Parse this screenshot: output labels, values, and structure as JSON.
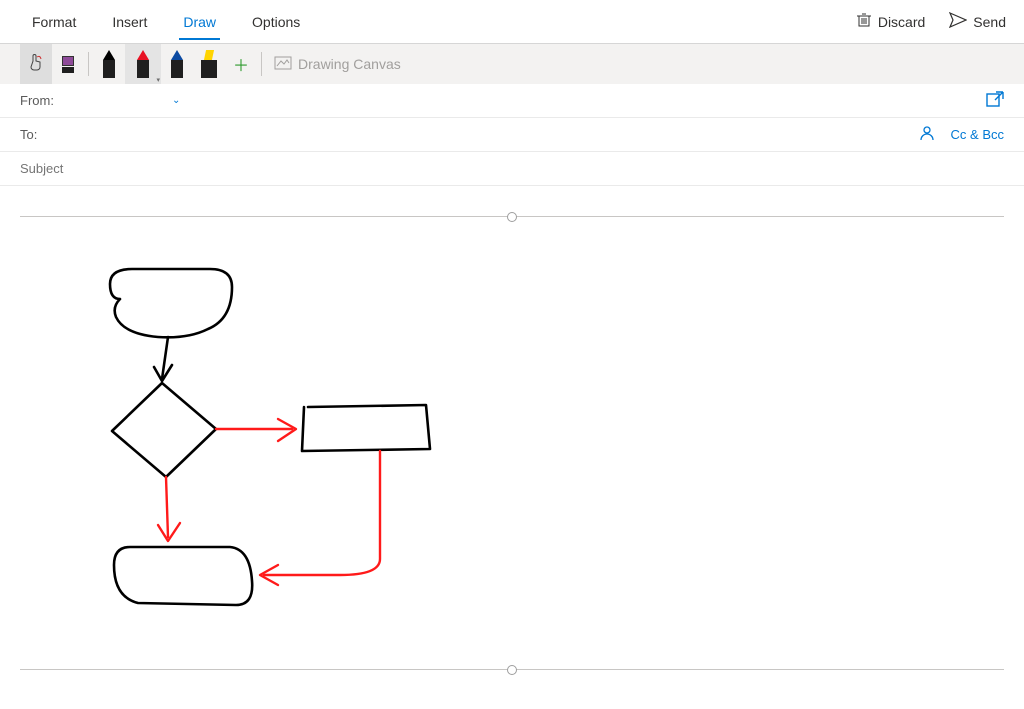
{
  "ribbon": {
    "tabs": {
      "format": "Format",
      "insert": "Insert",
      "draw": "Draw",
      "options": "Options"
    },
    "discard": "Discard",
    "send": "Send"
  },
  "draw_toolbar": {
    "canvas_label": "Drawing Canvas"
  },
  "fields": {
    "from_label": "From:",
    "to_label": "To:",
    "subject_label": "Subject",
    "ccbcc": "Cc & Bcc"
  },
  "icons": {
    "trash": "trash-icon",
    "send": "send-icon",
    "popout": "popout-icon",
    "people": "people-icon",
    "touch": "touch-icon",
    "eraser": "eraser-icon",
    "pen_black": "pen-black-icon",
    "pen_red": "pen-red-icon",
    "pen_blue": "pen-blue-icon",
    "highlighter": "highlighter-icon",
    "plus": "plus-icon",
    "canvas": "canvas-icon",
    "chevron": "chevron-down-icon"
  },
  "colors": {
    "accent": "#0078d4",
    "ink_black": "#000000",
    "ink_red": "#e81123",
    "ink_red_drawing": "#ff1a1a",
    "ink_blue": "#0b4aa2",
    "highlighter": "#ffd400"
  },
  "drawing": {
    "shapes": [
      "terminator",
      "arrow-down",
      "decision-diamond",
      "red-arrow-right",
      "process-box",
      "red-arrow-down",
      "rounded-rect",
      "red-connector-curve"
    ]
  }
}
